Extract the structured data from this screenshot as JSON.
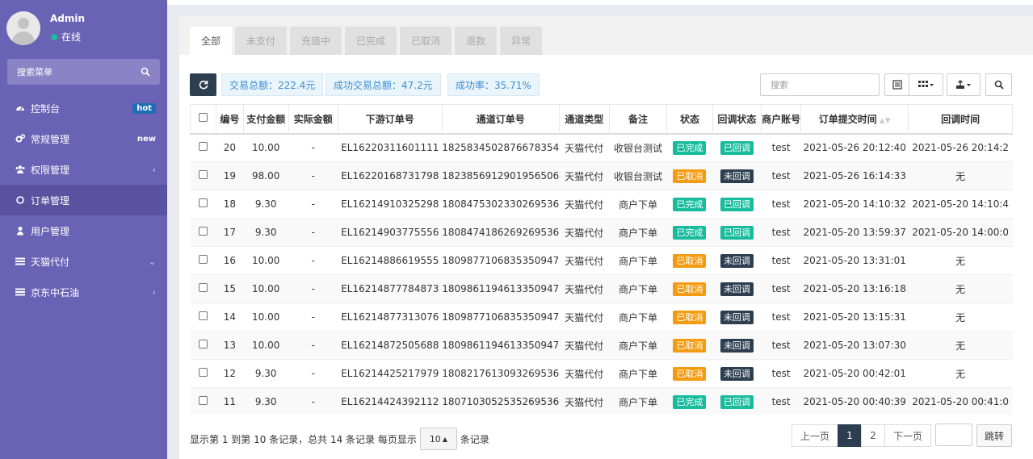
{
  "user": {
    "name": "Admin",
    "status": "在线"
  },
  "sidebar": {
    "search_placeholder": "搜索菜单",
    "items": [
      {
        "label": "控制台",
        "badge": "hot"
      },
      {
        "label": "常规管理",
        "badge": "new"
      },
      {
        "label": "权限管理",
        "chevron": "‹"
      },
      {
        "label": "订单管理"
      },
      {
        "label": "用户管理"
      },
      {
        "label": "天猫代付",
        "chevron": "⌄"
      },
      {
        "label": "京东中石油",
        "chevron": "‹"
      }
    ]
  },
  "tabs": [
    "全部",
    "未支付",
    "充值中",
    "已完成",
    "已取消",
    "退款",
    "异常"
  ],
  "stats": {
    "total": "交易总额：222.4元",
    "success_total": "成功交易总额：47.2元",
    "success_rate": "成功率：35.71%"
  },
  "search": {
    "placeholder": "搜索"
  },
  "table": {
    "headers": [
      "编号",
      "支付金额",
      "实际金额",
      "下游订单号",
      "通道订单号",
      "通道类型",
      "备注",
      "状态",
      "回调状态",
      "商户账号",
      "订单提交时间",
      "回调时间"
    ],
    "rows": [
      [
        "20",
        "10.00",
        "-",
        "EL16220311601111",
        "1825834502876678354",
        "天猫代付",
        "收银台测试",
        "已完成",
        "已回调",
        "test",
        "2021-05-26 20:12:40",
        "2021-05-26 20:14:2"
      ],
      [
        "19",
        "98.00",
        "-",
        "EL16220168731798",
        "1823856912901956506",
        "天猫代付",
        "收银台测试",
        "已取消",
        "未回调",
        "test",
        "2021-05-26 16:14:33",
        "无"
      ],
      [
        "18",
        "9.30",
        "-",
        "EL16214910325298",
        "1808475302330269536",
        "天猫代付",
        "商户下单",
        "已完成",
        "已回调",
        "test",
        "2021-05-20 14:10:32",
        "2021-05-20 14:10:4"
      ],
      [
        "17",
        "9.30",
        "-",
        "EL16214903775556",
        "1808474186269269536",
        "天猫代付",
        "商户下单",
        "已完成",
        "已回调",
        "test",
        "2021-05-20 13:59:37",
        "2021-05-20 14:00:0"
      ],
      [
        "16",
        "10.00",
        "-",
        "EL16214886619555",
        "1809877106835350947",
        "天猫代付",
        "商户下单",
        "已取消",
        "未回调",
        "test",
        "2021-05-20 13:31:01",
        "无"
      ],
      [
        "15",
        "10.00",
        "-",
        "EL16214877784873",
        "1809861194613350947",
        "天猫代付",
        "商户下单",
        "已取消",
        "未回调",
        "test",
        "2021-05-20 13:16:18",
        "无"
      ],
      [
        "14",
        "10.00",
        "-",
        "EL16214877313076",
        "1809877106835350947",
        "天猫代付",
        "商户下单",
        "已取消",
        "未回调",
        "test",
        "2021-05-20 13:15:31",
        "无"
      ],
      [
        "13",
        "10.00",
        "-",
        "EL16214872505688",
        "1809861194613350947",
        "天猫代付",
        "商户下单",
        "已取消",
        "未回调",
        "test",
        "2021-05-20 13:07:30",
        "无"
      ],
      [
        "12",
        "9.30",
        "-",
        "EL16214425217979",
        "1808217613093269536",
        "天猫代付",
        "商户下单",
        "已取消",
        "未回调",
        "test",
        "2021-05-20 00:42:01",
        "无"
      ],
      [
        "11",
        "9.30",
        "-",
        "EL16214424392112",
        "1807103052535269536",
        "天猫代付",
        "商户下单",
        "已完成",
        "已回调",
        "test",
        "2021-05-20 00:40:39",
        "2021-05-20 00:41:0"
      ]
    ]
  },
  "footer": {
    "info_prefix": "显示第 1 到第 10 条记录，总共 14 条记录 每页显示",
    "page_size": "10",
    "info_suffix": "条记录",
    "prev": "上一页",
    "pages": [
      "1",
      "2"
    ],
    "next": "下一页",
    "jump": "跳转"
  },
  "colors": {
    "sidebar_bg": "#6a62b4",
    "success": "#18bc9c",
    "warning": "#f39c12",
    "dark": "#2c3e50",
    "info": "#3a8ed4"
  }
}
